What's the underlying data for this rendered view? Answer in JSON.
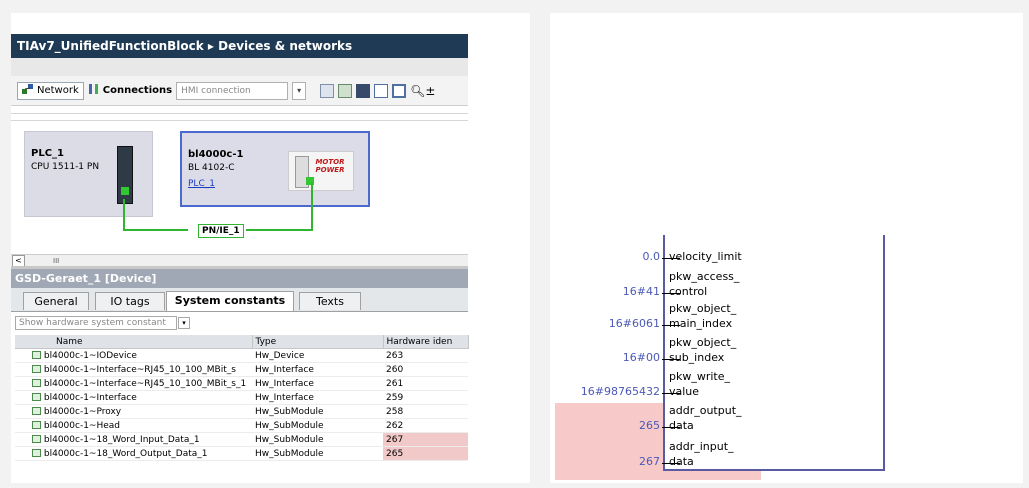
{
  "left_panel": {
    "title": "TIAv7_UnifiedFunctionBlock ▸ Devices & networks",
    "toolbar": {
      "network_label": "Network",
      "connections_label": "Connections",
      "hmi_connection_placeholder": "HMI connection"
    },
    "devices": [
      {
        "name": "PLC_1",
        "type": "CPU 1511-1 PN"
      },
      {
        "name": "bl4000c-1",
        "type": "BL 4102-C",
        "link": "PLC_1",
        "brand": "MOTOR POWER"
      }
    ],
    "network_label": "PN/IE_1",
    "scroll_mark": "III",
    "device_header": "GSD-Geraet_1 [Device]",
    "tabs": [
      "General",
      "IO tags",
      "System constants",
      "Texts"
    ],
    "active_tab": "System constants",
    "filter_placeholder": "Show hardware system constant",
    "table": {
      "columns": [
        "Name",
        "Type",
        "Hardware iden"
      ],
      "rows": [
        {
          "name": "bl4000c-1~IODevice",
          "type": "Hw_Device",
          "id": "263"
        },
        {
          "name": "bl4000c-1~Interface~RJ45_10_100_MBit_s",
          "type": "Hw_Interface",
          "id": "260"
        },
        {
          "name": "bl4000c-1~Interface~RJ45_10_100_MBit_s_1",
          "type": "Hw_Interface",
          "id": "261"
        },
        {
          "name": "bl4000c-1~Interface",
          "type": "Hw_Interface",
          "id": "259"
        },
        {
          "name": "bl4000c-1~Proxy",
          "type": "Hw_SubModule",
          "id": "258"
        },
        {
          "name": "bl4000c-1~Head",
          "type": "Hw_SubModule",
          "id": "262"
        },
        {
          "name": "bl4000c-1~18_Word_Input_Data_1",
          "type": "Hw_SubModule",
          "id": "267"
        },
        {
          "name": "bl4000c-1~18_Word_Output_Data_1",
          "type": "Hw_SubModule",
          "id": "265"
        }
      ]
    }
  },
  "right_panel": {
    "pins": [
      {
        "value": "0.0",
        "name": "velocity_limit",
        "name2": ""
      },
      {
        "value": "16#41",
        "name": "pkw_access_",
        "name2": "control"
      },
      {
        "value": "16#6061",
        "name": "pkw_object_",
        "name2": "main_index"
      },
      {
        "value": "16#00",
        "name": "pkw_object_",
        "name2": "sub_index"
      },
      {
        "value": "16#98765432",
        "name": "pkw_write_",
        "name2": "value"
      },
      {
        "value": "265",
        "name": "addr_output_",
        "name2": "data"
      },
      {
        "value": "267",
        "name": "addr_input_",
        "name2": "data"
      }
    ]
  },
  "colors": {
    "title_bar": "#1f3a55",
    "highlight": "#f1c9c9",
    "network_green": "#31b531",
    "pin_value_blue": "#4b59b6"
  }
}
